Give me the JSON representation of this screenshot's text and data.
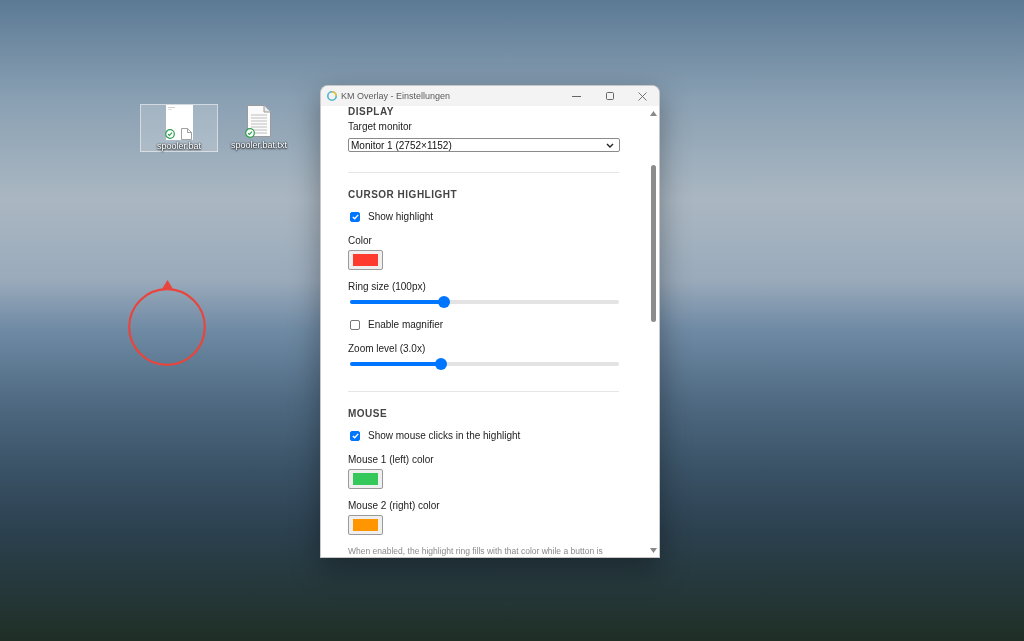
{
  "desktop": {
    "icons": [
      {
        "label": "spooler.bat",
        "kind": "file",
        "selected": true
      },
      {
        "label": "spooler.bat.txt",
        "kind": "text",
        "selected": false
      }
    ]
  },
  "window": {
    "title": "KM Overlay - Einstellungen"
  },
  "sections": [
    {
      "heading": "DISPLAY",
      "fields": [
        {
          "kind": "select",
          "label": "Target monitor",
          "value": "Monitor 1 (2752×1152)"
        }
      ]
    },
    {
      "heading": "CURSOR HIGHLIGHT",
      "fields": [
        {
          "kind": "checkbox",
          "label": "Show highlight",
          "checked": true
        },
        {
          "kind": "color",
          "label": "Color",
          "color": "#ff3b30"
        },
        {
          "kind": "slider",
          "label": "Ring size (100px)",
          "level": 0.35
        },
        {
          "kind": "checkbox",
          "label": "Enable magnifier",
          "checked": false
        },
        {
          "kind": "slider",
          "label": "Zoom level (3.0x)",
          "level": 0.34
        }
      ]
    },
    {
      "heading": "MOUSE",
      "fields": [
        {
          "kind": "checkbox",
          "label": "Show mouse clicks in the highlight",
          "checked": true
        },
        {
          "kind": "color",
          "label": "Mouse 1 (left) color",
          "color": "#34c759"
        },
        {
          "kind": "color",
          "label": "Mouse 2 (right) color",
          "color": "#ff9500"
        },
        {
          "kind": "hint",
          "text": "When enabled, the highlight ring fills with that color while a button is"
        }
      ]
    }
  ]
}
